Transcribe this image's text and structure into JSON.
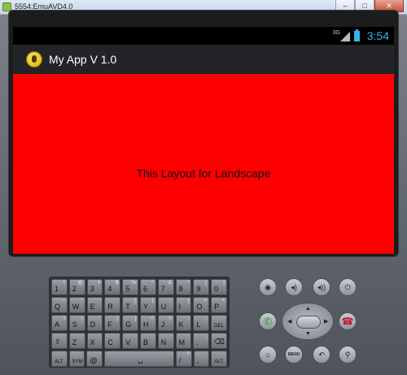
{
  "window": {
    "title": "5554:EmuAVD4.0",
    "controls": {
      "minimize": "–",
      "maximize": "□",
      "close": "✕"
    }
  },
  "status_bar": {
    "network": "3G",
    "time": "3:54",
    "icons": [
      "signal-icon",
      "battery-icon"
    ]
  },
  "action_bar": {
    "title": "My App V 1.0",
    "icon": "app-icon"
  },
  "content": {
    "message": "This Layout for Landscape",
    "background": "#fe0000"
  },
  "keyboard": {
    "rows": [
      [
        {
          "key": "1",
          "alt": "!"
        },
        {
          "key": "2",
          "alt": "@"
        },
        {
          "key": "3",
          "alt": "#"
        },
        {
          "key": "4",
          "alt": "$"
        },
        {
          "key": "5",
          "alt": "%"
        },
        {
          "key": "6",
          "alt": "^"
        },
        {
          "key": "7",
          "alt": "&"
        },
        {
          "key": "8",
          "alt": "*"
        },
        {
          "key": "9",
          "alt": "("
        },
        {
          "key": "0",
          "alt": ")"
        }
      ],
      [
        {
          "key": "Q",
          "alt": "~"
        },
        {
          "key": "W",
          "alt": "\""
        },
        {
          "key": "E",
          "alt": "'"
        },
        {
          "key": "R",
          "alt": "`"
        },
        {
          "key": "T",
          "alt": "{"
        },
        {
          "key": "Y",
          "alt": "}"
        },
        {
          "key": "U",
          "alt": "-"
        },
        {
          "key": "I",
          "alt": "["
        },
        {
          "key": "O",
          "alt": "="
        },
        {
          "key": "P",
          "alt": "+"
        }
      ],
      [
        {
          "key": "A",
          "alt": "\\"
        },
        {
          "key": "S",
          "alt": "|"
        },
        {
          "key": "D",
          "alt": "`"
        },
        {
          "key": "F",
          "alt": "["
        },
        {
          "key": "G",
          "alt": "]"
        },
        {
          "key": "H",
          "alt": "<"
        },
        {
          "key": "J",
          "alt": ">"
        },
        {
          "key": "K",
          "alt": ";"
        },
        {
          "key": "L",
          "alt": ":"
        },
        {
          "key": "DEL",
          "alt": ""
        }
      ],
      [
        {
          "key": "⇧",
          "alt": ""
        },
        {
          "key": "Z",
          "alt": ""
        },
        {
          "key": "X",
          "alt": ""
        },
        {
          "key": "C",
          "alt": ""
        },
        {
          "key": "V",
          "alt": ""
        },
        {
          "key": "B",
          "alt": ""
        },
        {
          "key": "N",
          "alt": ""
        },
        {
          "key": "M",
          "alt": ""
        },
        {
          "key": ".",
          "alt": ","
        },
        {
          "key": "⌫",
          "alt": ""
        }
      ],
      [
        {
          "key": "ALT",
          "alt": ""
        },
        {
          "key": "SYM",
          "alt": ""
        },
        {
          "key": "@",
          "alt": ""
        },
        {
          "key": "␣",
          "alt": ""
        },
        {
          "key": "/",
          "alt": "?"
        },
        {
          "key": ",",
          "alt": ""
        },
        {
          "key": "ALT",
          "alt": ""
        }
      ]
    ]
  },
  "controls": {
    "camera": "camera-icon",
    "volume_down": "volume-down-icon",
    "volume_up": "volume-up-icon",
    "power": "power-icon",
    "call": "call-icon",
    "end_call": "end-call-icon",
    "home": "home-icon",
    "menu_label": "MENU",
    "back": "back-icon",
    "search": "search-icon"
  }
}
